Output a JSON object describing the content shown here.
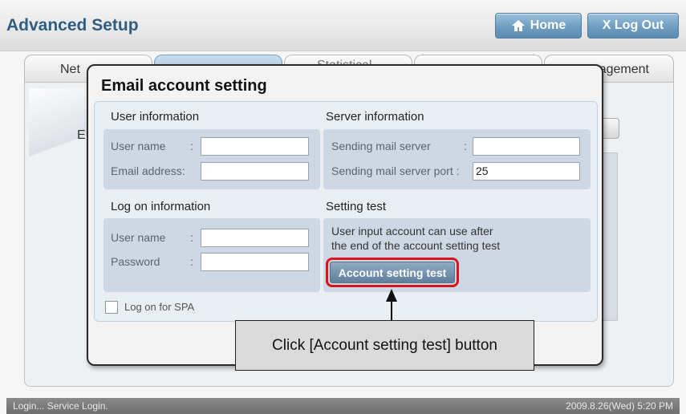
{
  "header": {
    "title": "Advanced Setup",
    "home_label": "Home",
    "logout_label": "X Log Out",
    "button_color": "#6f9dc0",
    "title_color": "#2f5d84"
  },
  "background_tabs": [
    {
      "label": "Net"
    },
    {
      "label": ""
    },
    {
      "label": "Statistical"
    },
    {
      "label": ""
    },
    {
      "label": "agement"
    }
  ],
  "background_text": "E",
  "dialog": {
    "title": "Email account setting",
    "user_info": {
      "title": "User information",
      "user_name_label": "User name",
      "user_name_colon": ":",
      "email_label": "Email address:",
      "user_name_value": "",
      "email_value": ""
    },
    "server_info": {
      "title": "Server information",
      "server_label": "Sending mail server",
      "server_colon": ":",
      "port_label": "Sending mail server port :",
      "server_value": "",
      "port_value": "25"
    },
    "logon_info": {
      "title": "Log on information",
      "user_name_label": "User name",
      "user_name_colon": ":",
      "password_label": "Password",
      "password_colon": ":",
      "user_name_value": "",
      "password_value": ""
    },
    "setting_test": {
      "title": "Setting test",
      "line1": "User input account can use after",
      "line2": "the end of the account setting test",
      "button_label": "Account setting test"
    },
    "checkbox_label": "Log on for SPA",
    "checkbox_checked": false
  },
  "callout": {
    "text": "Click [Account setting test] button",
    "highlight_color": "#d8141a"
  },
  "status_bar": {
    "left_text": "Login... Service Login.",
    "right_text": "2009.8.26(Wed) 5:20 PM"
  }
}
